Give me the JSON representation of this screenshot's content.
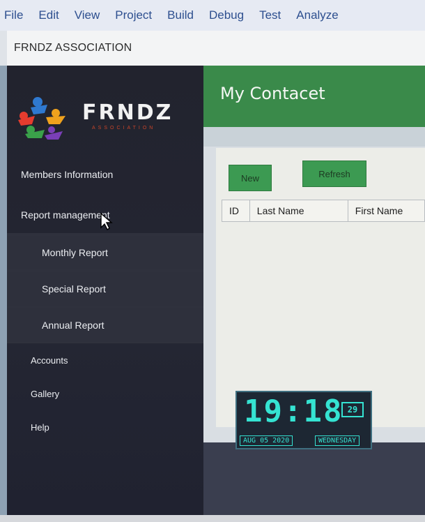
{
  "menubar": {
    "items": [
      "File",
      "Edit",
      "View",
      "Project",
      "Build",
      "Debug",
      "Test",
      "Analyze"
    ]
  },
  "window": {
    "title": "FRNDZ ASSOCIATION"
  },
  "logo": {
    "text": "FRNDZ",
    "subtext": "ASSOCIATION",
    "colors": [
      "#e53c2e",
      "#2f79d0",
      "#f0a21d",
      "#3aa14a",
      "#7a3fb7"
    ]
  },
  "sidebar": {
    "items": [
      {
        "label": "Members Information",
        "level": "top"
      },
      {
        "label": "Report management",
        "level": "top"
      },
      {
        "label": "Monthly Report",
        "level": "sub"
      },
      {
        "label": "Special Report",
        "level": "sub"
      },
      {
        "label": "Annual Report",
        "level": "sub"
      },
      {
        "label": "Accounts",
        "level": "small"
      },
      {
        "label": "Gallery",
        "level": "small"
      },
      {
        "label": "Help",
        "level": "small"
      }
    ]
  },
  "main": {
    "title": "My Contacet",
    "buttons": {
      "new_label": "New",
      "refresh_label": "Refresh"
    },
    "grid": {
      "columns": [
        "ID",
        "Last Name",
        "First Name"
      ]
    }
  },
  "clock": {
    "time": "19:18",
    "seconds": "29",
    "date": "AUG 05 2020",
    "day": "WEDNESDAY"
  },
  "colors": {
    "header_green": "#3a8a4a",
    "sidebar_dark": "#23242f",
    "clock_cyan": "#35e3d2"
  }
}
